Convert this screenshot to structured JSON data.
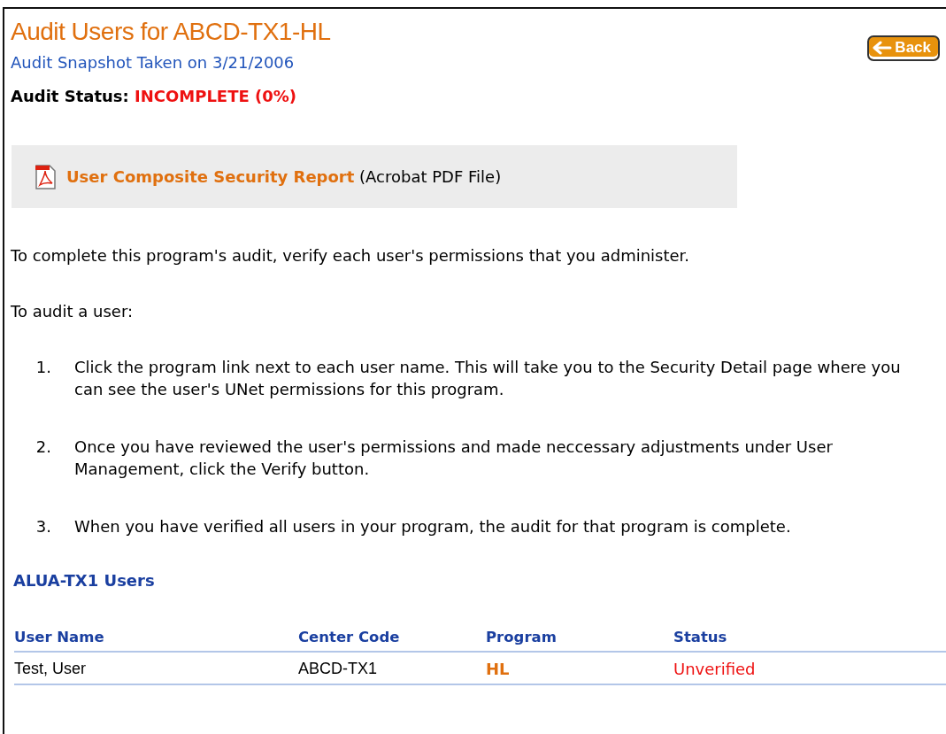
{
  "header": {
    "title": "Audit Users for ABCD-TX1-HL",
    "snapshot": "Audit Snapshot Taken on 3/21/2006",
    "status_label": "Audit Status:",
    "status_value": "INCOMPLETE (0%)",
    "back_button": "Back"
  },
  "report": {
    "link": "User Composite Security Report",
    "note": "(Acrobat PDF File)"
  },
  "intro": "To complete this program's audit, verify each user's permissions that you administer.",
  "steps_heading": "To audit a user:",
  "steps": [
    {
      "number": "1.",
      "text": "Click the program link next to each user name. This will take you to the Security Detail page where you can see the user's UNet permissions for this program."
    },
    {
      "number": "2.",
      "text": "Once you have reviewed the user's permissions and made neccessary adjustments under User Management, click the Verify button."
    },
    {
      "number": "3.",
      "text": "When you have verified all users in your program, the audit for that program is complete."
    }
  ],
  "section": {
    "title": "ALUA-TX1 Users"
  },
  "table": {
    "columns": [
      "User Name",
      "Center Code",
      "Program",
      "Status"
    ],
    "rows": [
      {
        "user_name": "Test, User",
        "center_code": "ABCD-TX1",
        "program": "HL",
        "status": "Unverified"
      }
    ]
  }
}
